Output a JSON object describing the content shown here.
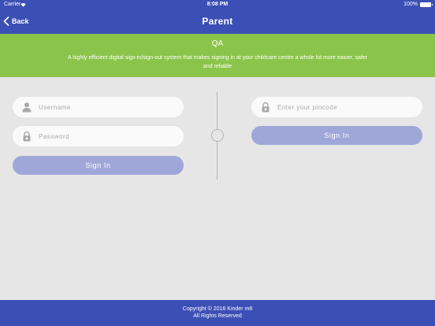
{
  "status_bar": {
    "carrier": "Carrier",
    "time": "8:08 PM",
    "battery": "100%"
  },
  "nav": {
    "back_label": "Back",
    "title": "Parent"
  },
  "banner": {
    "org_name": "QA",
    "tagline": "A highly efficient digital sign-in/sign-out system that makes signing in at your childcare centre a whole lot more easier, safer and reliable"
  },
  "login_form": {
    "username_placeholder": "Username",
    "username_value": "",
    "password_placeholder": "Password",
    "password_value": "",
    "sign_in_label": "Sign In"
  },
  "pincode_form": {
    "pincode_placeholder": "Enter your pincode",
    "pincode_value": "",
    "sign_in_label": "Sign In"
  },
  "footer": {
    "copyright": "Copyright © 2016 Kinder m8",
    "rights": "All Rights Reserved"
  },
  "colors": {
    "nav": "#3c4fb4",
    "banner": "#8bc44a",
    "button": "#9ea7d8",
    "background": "#e6e6e6"
  },
  "icons": {
    "back": "chevron-left-icon",
    "username": "user-icon",
    "password": "padlock-icon",
    "pincode": "padlock-icon"
  }
}
